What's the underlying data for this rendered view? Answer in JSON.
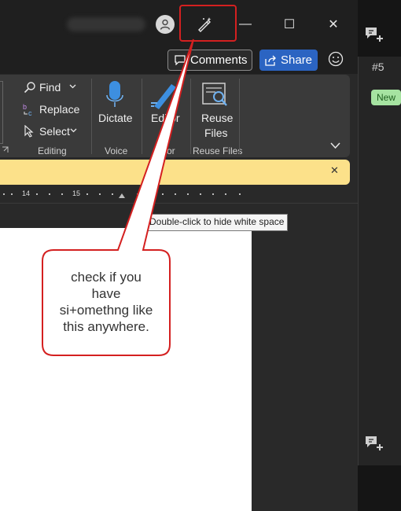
{
  "titlebar": {
    "minimize_symbol": "—",
    "maximize_symbol": "☐",
    "close_symbol": "✕",
    "icons": [
      "account-icon",
      "designer-icon"
    ]
  },
  "action_bar": {
    "comments_label": "Comments",
    "share_label": "Share"
  },
  "ribbon": {
    "find_label": "Find",
    "replace_label": "Replace",
    "select_label": "Select",
    "editing_group": "Editing",
    "dictate_label": "Dictate",
    "voice_group": "Voice",
    "editor_label": "Editor",
    "editor_group": "or",
    "reuse_label_1": "Reuse",
    "reuse_label_2": "Files",
    "reuse_group": "Reuse Files"
  },
  "notification": {
    "close_symbol": "✕"
  },
  "ruler": {
    "labels": [
      "14",
      "15"
    ]
  },
  "tooltip": {
    "text": "Double-click to hide white space"
  },
  "right_panel": {
    "card_number": "#5",
    "new_badge": "New"
  },
  "callout": {
    "line1": "check if you",
    "line2": "have",
    "line3": "si+omethng like",
    "line4": "this anywhere."
  },
  "colors": {
    "highlight": "#d42020",
    "share": "#2b64c2",
    "notification": "#fce18a",
    "new_badge": "#a6e3a1"
  }
}
